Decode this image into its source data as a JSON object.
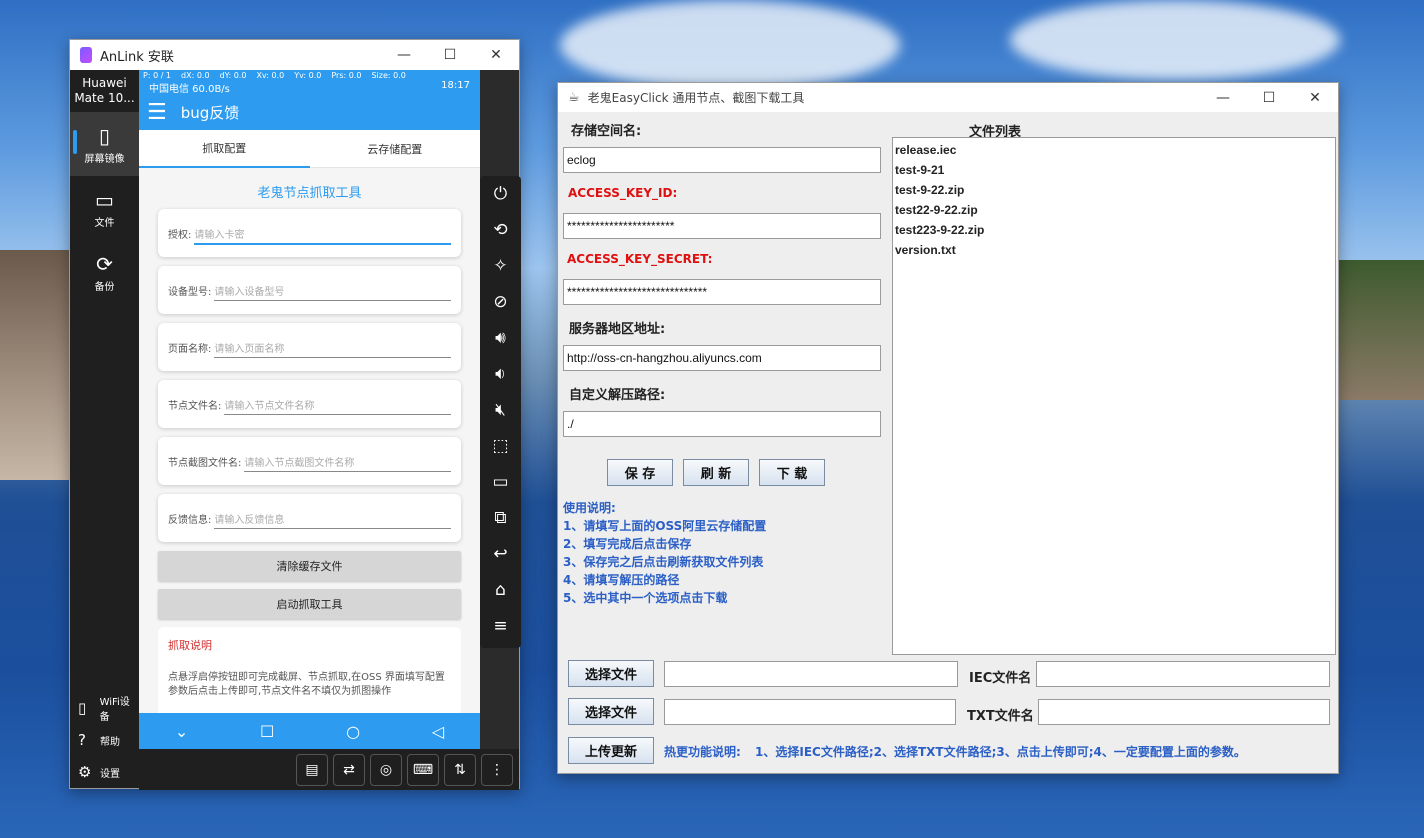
{
  "anlink": {
    "title": "AnLink 安联",
    "device_name": "Huawei Mate 10...",
    "nav": [
      {
        "label": "屏幕镜像",
        "icon": "phone-icon"
      },
      {
        "label": "文件",
        "icon": "folder-icon"
      },
      {
        "label": "备份",
        "icon": "sync-icon"
      }
    ],
    "bottom_links": [
      {
        "label": "WiFi设备",
        "icon": "wifi-device-icon"
      },
      {
        "label": "帮助",
        "icon": "help-icon"
      },
      {
        "label": "设置",
        "icon": "gear-icon"
      }
    ],
    "phone": {
      "debug_line": [
        "P: 0 / 1",
        "dX: 0.0",
        "dY: 0.0",
        "Xv: 0.0",
        "Yv: 0.0",
        "Prs: 0.0",
        "Size: 0.0"
      ],
      "status_left": "中国电信 60.0B/s",
      "status_right": "18:17",
      "appbar_title": "bug反馈",
      "tabs": [
        "抓取配置",
        "云存储配置"
      ],
      "form_title": "老鬼节点抓取工具",
      "fields": [
        {
          "label": "授权:",
          "placeholder": "请输入卡密"
        },
        {
          "label": "设备型号:",
          "placeholder": "请输入设备型号"
        },
        {
          "label": "页面名称:",
          "placeholder": "请输入页面名称"
        },
        {
          "label": "节点文件名:",
          "placeholder": "请输入节点文件名称"
        },
        {
          "label": "节点截图文件名:",
          "placeholder": "请输入节点截图文件名称"
        },
        {
          "label": "反馈信息:",
          "placeholder": "请输入反馈信息"
        }
      ],
      "clear_button": "清除缓存文件",
      "start_button": "启动抓取工具",
      "desc_title": "抓取说明",
      "desc_text": "点悬浮启停按钮即可完成截屏、节点抓取,在OSS 界面填写配置参数后点击上传即可,节点文件名不填仅为抓图操作"
    }
  },
  "easyclick": {
    "title": "老鬼EasyClick 通用节点、截图下载工具",
    "bucket_label": "存储空间名:",
    "bucket_value": "eclog",
    "key_id_label": "ACCESS_KEY_ID:",
    "key_id_value": "***********************",
    "key_secret_label": "ACCESS_KEY_SECRET:",
    "key_secret_value": "******************************",
    "region_label": "服务器地区地址:",
    "region_value": "http://oss-cn-hangzhou.aliyuncs.com",
    "path_label": "自定义解压路径:",
    "path_value": "./",
    "buttons": {
      "save": "保 存",
      "refresh": "刷 新",
      "download": "下 载"
    },
    "usage": [
      "使用说明:",
      "1、请填写上面的OSS阿里云存储配置",
      "2、填写完成后点击保存",
      "3、保存完之后点击刷新获取文件列表",
      "4、请填写解压的路径",
      "5、选中其中一个选项点击下载"
    ],
    "file_list_title": "文件列表",
    "files": [
      "release.iec",
      "test-9-21",
      "test-9-22.zip",
      "test22-9-22.zip",
      "test223-9-22.zip",
      "version.txt"
    ],
    "choose_file_1": "选择文件",
    "choose_file_2": "选择文件",
    "iec_label": "IEC文件名",
    "txt_label": "TXT文件名",
    "upload_button": "上传更新",
    "hint_label": "热更功能说明:",
    "hint_text": "1、选择IEC文件路径;2、选择TXT文件路径;3、点击上传即可;4、一定要配置上面的参数。"
  }
}
